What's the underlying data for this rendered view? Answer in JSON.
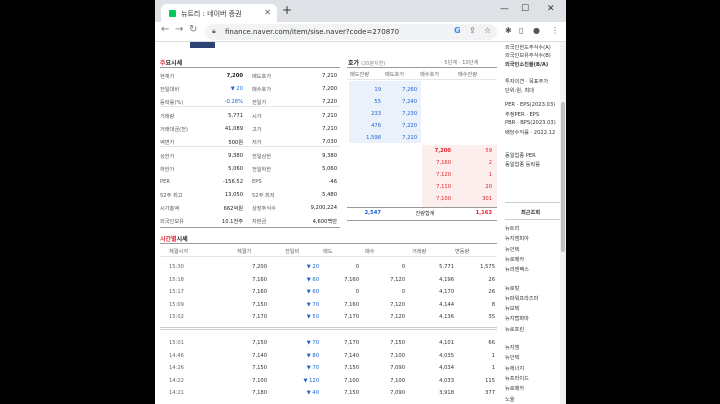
{
  "browser": {
    "tab_title": "뉴트리 : 네이버 증권",
    "url": "finance.naver.com/item/sise.naver?code=270870"
  },
  "quote": {
    "title_prefix": "주",
    "title_rest": "요시세",
    "left_rows": [
      {
        "label": "현재가",
        "value": "7,200"
      },
      {
        "label": "전일대비",
        "value": "▼ 20"
      },
      {
        "label": "등락률(%)",
        "value": "-0.28%"
      },
      {
        "label": "거래량",
        "value": "5,771"
      },
      {
        "label": "거래대금(천)",
        "value": "41,089"
      },
      {
        "label": "액면가",
        "value": "500원"
      },
      {
        "label": "상한가",
        "value": "9,380"
      },
      {
        "label": "하한가",
        "value": "5,060"
      },
      {
        "label": "PER",
        "value": "-156.52"
      },
      {
        "label": "52주 최고",
        "value": "13,050"
      },
      {
        "label": "시가총액",
        "value": "662억원"
      },
      {
        "label": "외국인보유",
        "value": "10.1천주"
      }
    ],
    "right_rows": [
      {
        "label": "매도호가",
        "value": "7,210"
      },
      {
        "label": "매수호가",
        "value": "7,200"
      },
      {
        "label": "전일가",
        "value": "7,220"
      },
      {
        "label": "시가",
        "value": "7,210"
      },
      {
        "label": "고가",
        "value": "7,210"
      },
      {
        "label": "저가",
        "value": "7,030"
      },
      {
        "label": "전일상한",
        "value": "9,380"
      },
      {
        "label": "전일하한",
        "value": "5,060"
      },
      {
        "label": "EPS",
        "value": "-46"
      },
      {
        "label": "52주 최저",
        "value": "5,480"
      },
      {
        "label": "상장주식수",
        "value": "9,200,224"
      },
      {
        "label": "자본금",
        "value": "4,600백만"
      }
    ]
  },
  "orderbook": {
    "title": "호가",
    "subtitle": "(20분지연)",
    "links": "· 5단계 · 10단계",
    "headers": [
      "매도잔량",
      "매도호가",
      "매수호가",
      "매수잔량"
    ],
    "asks": [
      {
        "qty": "19",
        "price": "7,260"
      },
      {
        "qty": "55",
        "price": "7,240"
      },
      {
        "qty": "233",
        "price": "7,230"
      },
      {
        "qty": "476",
        "price": "7,220"
      },
      {
        "qty": "1,598",
        "price": "7,210"
      }
    ],
    "bids": [
      {
        "price": "7,200",
        "qty": "59"
      },
      {
        "price": "7,160",
        "qty": "2"
      },
      {
        "price": "7,120",
        "qty": "1"
      },
      {
        "price": "7,110",
        "qty": "20"
      },
      {
        "price": "7,100",
        "qty": "301"
      }
    ],
    "total_ask": "2,547",
    "total_label": "잔량합계",
    "total_bid": "1,163"
  },
  "ticks": {
    "title_prefix": "시간별",
    "title_rest": "시세",
    "headers": [
      "체결시각",
      "체결가",
      "전일비",
      "매도",
      "매수",
      "거래량",
      "변동량"
    ],
    "rows": [
      [
        "15:30",
        "7,200",
        "▼ 20",
        "0",
        "0",
        "5,771",
        "1,575"
      ],
      [
        "15:18",
        "7,160",
        "▼ 60",
        "7,160",
        "7,120",
        "4,196",
        "26"
      ],
      [
        "15:17",
        "7,160",
        "▼ 60",
        "0",
        "0",
        "4,170",
        "26"
      ],
      [
        "15:09",
        "7,150",
        "▼ 70",
        "7,160",
        "7,120",
        "4,144",
        "8"
      ],
      [
        "15:02",
        "7,170",
        "▼ 50",
        "7,170",
        "7,120",
        "4,136",
        "35"
      ],
      [
        "15:01",
        "7,150",
        "▼ 70",
        "7,170",
        "7,150",
        "4,101",
        "66"
      ],
      [
        "14:46",
        "7,140",
        "▼ 80",
        "7,140",
        "7,100",
        "4,035",
        "1"
      ],
      [
        "14:26",
        "7,150",
        "▼ 70",
        "7,150",
        "7,090",
        "4,034",
        "1"
      ],
      [
        "14:22",
        "7,100",
        "▼ 120",
        "7,100",
        "7,100",
        "4,033",
        "115"
      ],
      [
        "14:21",
        "7,180",
        "▼ 40",
        "7,150",
        "7,090",
        "3,918",
        "377"
      ]
    ]
  },
  "sidebar": {
    "top_items": [
      "외국인한도주식수(A)",
      "외국인보유주식수(B)",
      "외국인소진율(B/A)",
      "투자의견 · 목표주가",
      "단위:원, 최대",
      "PER · EPS(2023.03)",
      "추정PER · EPS",
      "PBR · BPS(2023.03)",
      "배당수익률 · 2022.12",
      "동일업종 PER",
      "동일업종 등락률"
    ],
    "recent_title": "최근조회",
    "recent_items": [
      "뉴트리",
      "뉴지엠피아",
      "뉴인텍",
      "뉴로메카",
      "뉴리젠팩스",
      "뉴로핏",
      "뉴파워프라즈마",
      "뉴보텍",
      "뉴지랩파마",
      "뉴로프린",
      "뉴지엠",
      "뉴인텍",
      "뉴에너지",
      "뉴프라이드",
      "뉴로메카",
      "노을"
    ]
  }
}
